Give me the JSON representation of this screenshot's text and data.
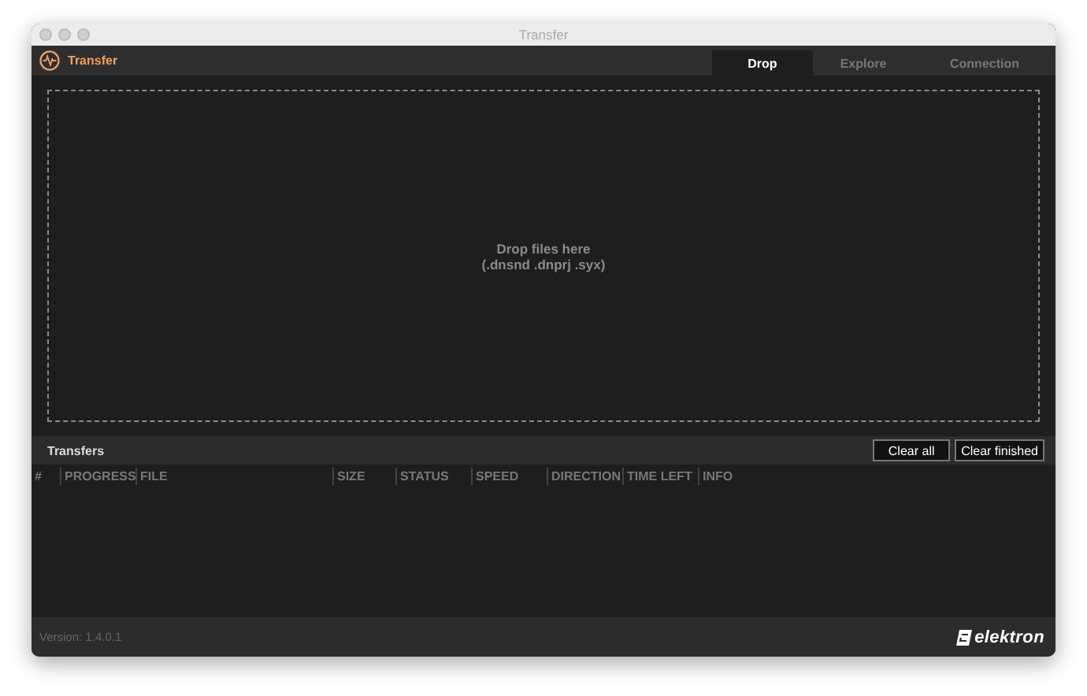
{
  "window": {
    "title": "Transfer"
  },
  "app": {
    "name": "Transfer"
  },
  "tabs": [
    {
      "label": "Drop",
      "selected": true
    },
    {
      "label": "Explore",
      "selected": false
    },
    {
      "label": "Connection",
      "selected": false
    }
  ],
  "drop_zone": {
    "line_1": "Drop files here",
    "line_2": "(.dnsnd .dnprj .syx)"
  },
  "transfers": {
    "title": "Transfers",
    "buttons": [
      "Clear all",
      "Clear finished"
    ],
    "columns": [
      "#",
      "PROGRESS",
      "FILE",
      "SIZE",
      "STATUS",
      "SPEED",
      "DIRECTION",
      "TIME LEFT",
      "INFO"
    ]
  },
  "status_bar": {
    "version": "Version: 1.4.0.1",
    "logo": "elektron"
  }
}
